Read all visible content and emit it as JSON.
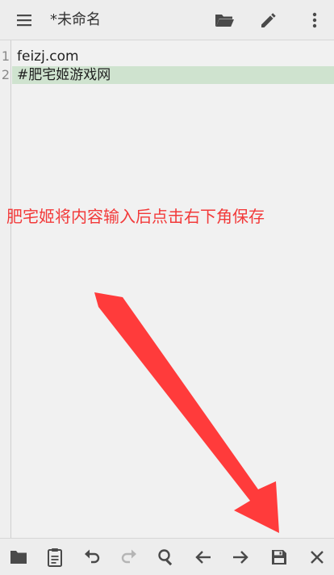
{
  "toolbar": {
    "title": "*未命名",
    "icons": [
      "menu-icon",
      "folder-open-icon",
      "edit-icon",
      "more-vert-icon"
    ]
  },
  "editor": {
    "lines": [
      {
        "number": "1",
        "text": "feizj.com"
      },
      {
        "number": "2",
        "text": "#肥宅姬游戏网"
      }
    ],
    "current_line": 2
  },
  "annotation": {
    "text": "肥宅姬将内容输入后点击右下角保存",
    "color": "#f23a3a"
  },
  "bottom_toolbar": {
    "icons": [
      "folder-icon",
      "clipboard-icon",
      "undo-icon",
      "redo-icon",
      "search-icon",
      "arrow-left-icon",
      "arrow-right-icon",
      "save-icon",
      "close-icon"
    ],
    "disabled": [
      "redo-icon"
    ]
  },
  "colors": {
    "icon": "#4a4a4a",
    "disabled_icon": "#b5b5b5",
    "current_line_bg": "#cfe3cf",
    "arrow": "#ff3b3b"
  }
}
